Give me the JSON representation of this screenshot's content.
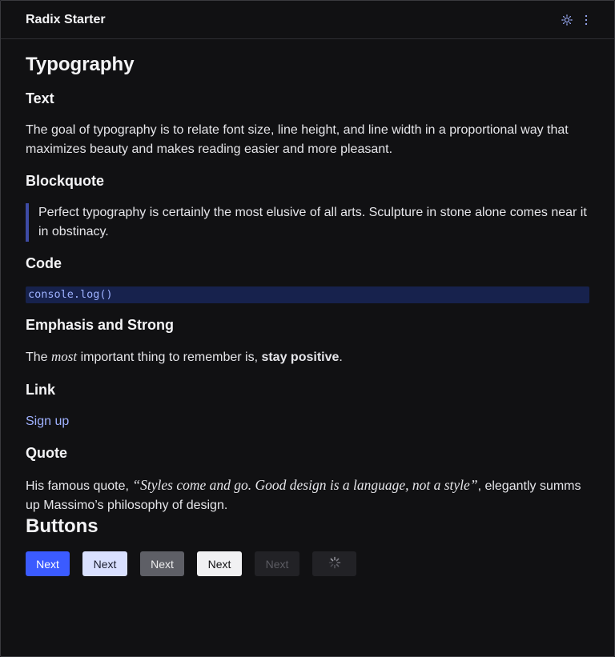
{
  "header": {
    "app_title": "Radix Starter",
    "icons": [
      "sun-icon",
      "vertical-dots-icon"
    ]
  },
  "page": {
    "title": "Typography"
  },
  "sections": {
    "text": {
      "heading": "Text",
      "body": "The goal of typography is to relate font size, line height, and line width in a proportional way that maximizes beauty and makes reading easier and more pleasant."
    },
    "blockquote": {
      "heading": "Blockquote",
      "body": "Perfect typography is certainly the most elusive of all arts. Sculpture in stone alone comes near it in obstinacy."
    },
    "code": {
      "heading": "Code",
      "body": "console.log()"
    },
    "emphasis": {
      "heading": "Emphasis and Strong",
      "before": "The ",
      "em": "most",
      "middle": " important thing to remember is, ",
      "strong": "stay positive",
      "after": "."
    },
    "link": {
      "heading": "Link",
      "text": "Sign up"
    },
    "quote": {
      "heading": "Quote",
      "before": "His famous quote, ",
      "quote": "“Styles come and go. Good design is a language, not a style”",
      "after": ", elegantly summs up Massimo’s philosophy of design."
    }
  },
  "buttons": {
    "heading": "Buttons",
    "labels": [
      "Next",
      "Next",
      "Next",
      "Next",
      "Next"
    ],
    "loading_icon": "spinner-icon"
  },
  "colors": {
    "background": "#111113",
    "accent": "#3b5bff",
    "link": "#9fb1ff",
    "code_bg": "#17224d",
    "blockquote_border": "#3e4ba5"
  }
}
